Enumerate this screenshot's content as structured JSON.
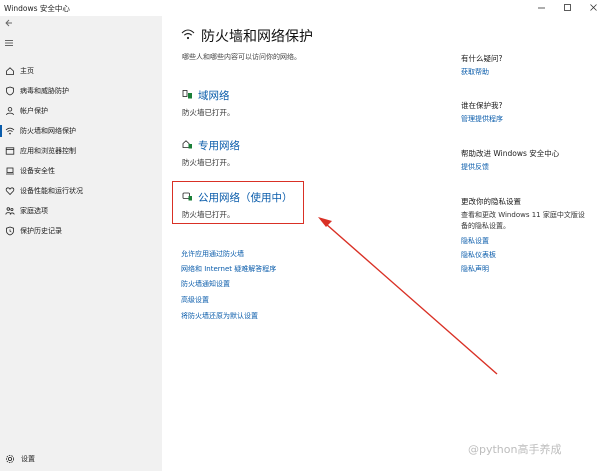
{
  "window": {
    "title": "Windows 安全中心"
  },
  "sidebar": {
    "items": [
      {
        "label": "主页",
        "icon": "home-icon"
      },
      {
        "label": "病毒和威胁防护",
        "icon": "shield-icon"
      },
      {
        "label": "帐户保护",
        "icon": "person-icon"
      },
      {
        "label": "防火墙和网络保护",
        "icon": "wifi-icon"
      },
      {
        "label": "应用和浏览器控制",
        "icon": "app-window-icon"
      },
      {
        "label": "设备安全性",
        "icon": "laptop-icon"
      },
      {
        "label": "设备性能和运行状况",
        "icon": "heart-icon"
      },
      {
        "label": "家庭选项",
        "icon": "family-icon"
      },
      {
        "label": "保护历史记录",
        "icon": "history-icon"
      }
    ],
    "active_index": 3,
    "settings_label": "设置"
  },
  "main": {
    "title": "防火墙和网络保护",
    "subtitle": "哪些人和哪些内容可以访问你的网络。",
    "networks": [
      {
        "name": "域网络",
        "status": "防火墙已打开。"
      },
      {
        "name": "专用网络",
        "status": "防火墙已打开。"
      },
      {
        "name": "公用网络（使用中）",
        "status": "防火墙已打开。"
      }
    ],
    "links": [
      "允许应用通过防火墙",
      "网络和 Internet 疑难解答程序",
      "防火墙通知设置",
      "高级设置",
      "将防火墙还原为默认设置"
    ]
  },
  "right": {
    "question": {
      "heading": "有什么疑问?",
      "link": "获取帮助"
    },
    "protecting": {
      "heading": "谁在保护我?",
      "link": "管理提供程序"
    },
    "improve": {
      "heading": "帮助改进 Windows 安全中心",
      "link": "提供反馈"
    },
    "privacy": {
      "heading": "更改你的隐私设置",
      "text": "查看和更改 Windows 11 家庭中文版设备的隐私设置。",
      "links": [
        "隐私设置",
        "隐私仪表板",
        "隐私声明"
      ]
    }
  },
  "watermark": "@python高手养成",
  "colors": {
    "accent": "#0a5cab",
    "highlight": "#d93025",
    "sidebar_bg": "#f1f1f1"
  }
}
